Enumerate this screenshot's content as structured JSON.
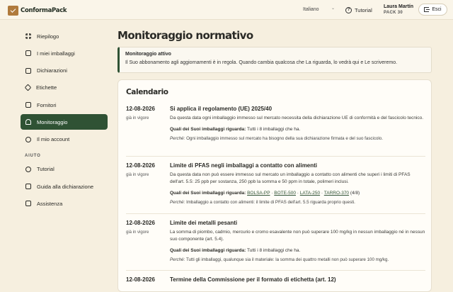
{
  "header": {
    "logo_text": "ConformaPack",
    "language": "Italiano",
    "tutorial_label": "Tutorial",
    "user_name": "Laura Martín",
    "user_plan": "PACK 30",
    "logout_label": "Esci"
  },
  "sidebar": {
    "items": [
      {
        "label": "Riepilogo",
        "icon": "grid-icon"
      },
      {
        "label": "I miei imballaggi",
        "icon": "box-icon"
      },
      {
        "label": "Dichiarazioni",
        "icon": "document-icon"
      },
      {
        "label": "Etichette",
        "icon": "tag-icon"
      },
      {
        "label": "Fornitori",
        "icon": "truck-icon"
      },
      {
        "label": "Monitoraggio",
        "icon": "bell-icon",
        "active": true
      },
      {
        "label": "Il mio account",
        "icon": "user-icon"
      }
    ],
    "help_section_label": "AIUTO",
    "help_items": [
      {
        "label": "Tutorial",
        "icon": "help-circle-icon"
      },
      {
        "label": "Guida alla dichiarazione",
        "icon": "book-icon"
      },
      {
        "label": "Assistenza",
        "icon": "mail-icon"
      }
    ]
  },
  "main": {
    "title": "Monitoraggio normativo",
    "alert_title": "Monitoraggio attivo",
    "alert_text": "Il Suo abbonamento agli aggiornamenti è in regola. Quando cambia qualcosa che La riguarda, lo vedrà qui e Le scriveremo.",
    "calendar_title": "Calendario",
    "entries": [
      {
        "date": "12-08-2026",
        "status": "già in vigore",
        "title": "Si applica il regolamento (UE) 2025/40",
        "description": "Da questa data ogni imballaggio immesso sul mercato necessita della dichiarazione UE di conformità e del fascicolo tecnico.",
        "which_label": "Quali dei Suoi imballaggi riguarda:",
        "which_text": "Tutti i 8 imballaggi che ha.",
        "why_label": "Perché:",
        "why_text": "Ogni imballaggio immesso sul mercato ha bisogno della sua dichiarazione firmata e del suo fascicolo."
      },
      {
        "date": "12-08-2026",
        "status": "già in vigore",
        "title": "Limite di PFAS negli imballaggi a contatto con alimenti",
        "description": "Da questa data non può essere immesso sul mercato un imballaggio a contatto con alimenti che superi i limiti di PFAS dell'art. 5.5: 25 ppb per sostanza, 250 ppb la somma e 50 ppm in totale, polimeri inclusi.",
        "which_label": "Quali dei Suoi imballaggi riguarda:",
        "packages": [
          "BOLSA-PP",
          "BOTE-500",
          "LATA-250",
          "TARRO-370"
        ],
        "count": "(4/8)",
        "why_label": "Perché:",
        "why_text": "Imballaggio a contatto con alimenti: il limite di PFAS dell'art. 5.5 riguarda proprio questi."
      },
      {
        "date": "12-08-2026",
        "status": "già in vigore",
        "title": "Limite dei metalli pesanti",
        "description": "La somma di piombo, cadmio, mercurio e cromo esavalente non può superare 100 mg/kg in nessun imballaggio né in nessun suo componente (art. 5.4).",
        "which_label": "Quali dei Suoi imballaggi riguarda:",
        "which_text": "Tutti i 8 imballaggi che ha.",
        "why_label": "Perché:",
        "why_text": "Tutti gli imballaggi, qualunque sia il materiale: la somma dei quattro metalli non può superare 100 mg/kg."
      },
      {
        "date": "12-08-2026",
        "title": "Termine della Commissione per il formato di etichetta (art. 12)"
      }
    ]
  },
  "colors": {
    "accent": "#2f5234",
    "background": "#f6efdf",
    "brand": "#b07a3c"
  }
}
